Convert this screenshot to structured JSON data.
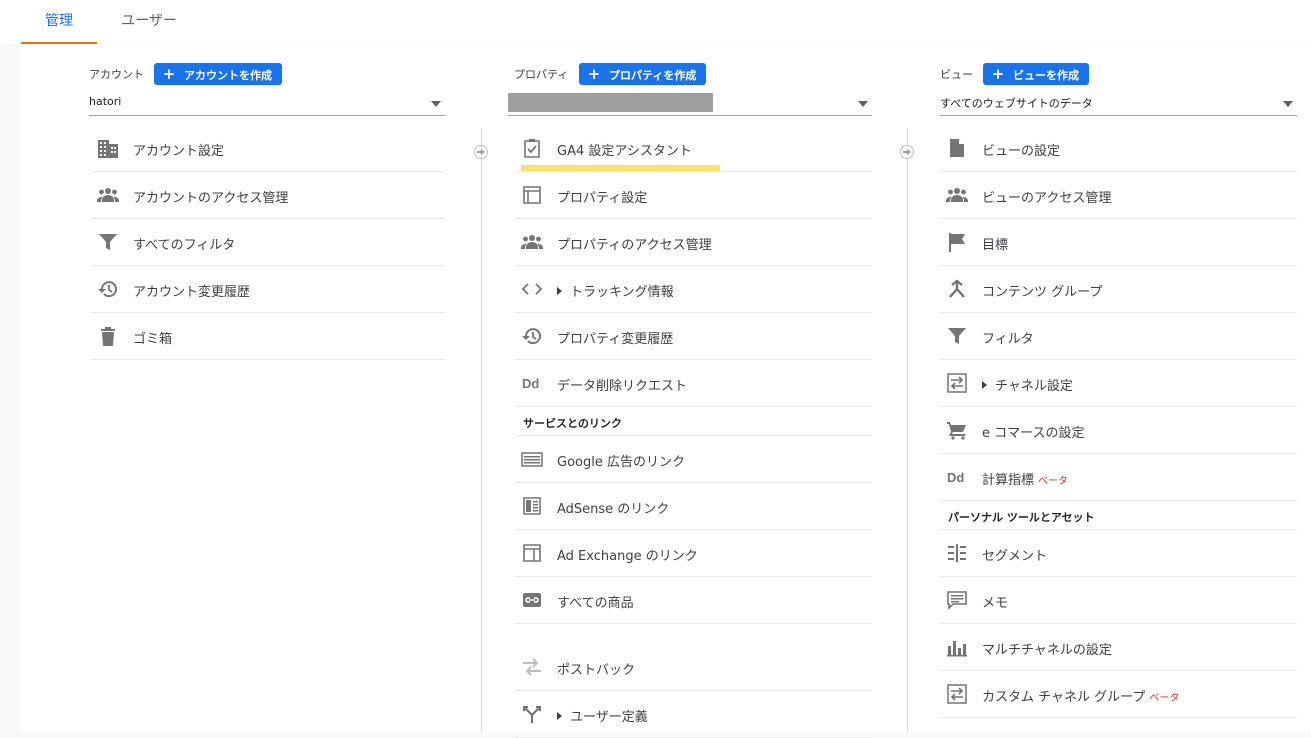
{
  "tabs": [
    {
      "label": "管理",
      "active": true
    },
    {
      "label": "ユーザー",
      "active": false
    }
  ],
  "account": {
    "label": "アカウント",
    "create_label": "アカウントを作成",
    "selected": "hatori",
    "items": [
      {
        "icon": "building-icon",
        "label": "アカウント設定"
      },
      {
        "icon": "people-icon",
        "label": "アカウントのアクセス管理"
      },
      {
        "icon": "filter-icon",
        "label": "すべてのフィルタ"
      },
      {
        "icon": "history-icon",
        "label": "アカウント変更履歴"
      },
      {
        "icon": "trash-icon",
        "label": "ゴミ箱"
      }
    ]
  },
  "property": {
    "label": "プロパティ",
    "create_label": "プロパティを作成",
    "selected": "",
    "items": [
      {
        "icon": "clipboard-check-icon",
        "label": "GA4 設定アシスタント"
      },
      {
        "icon": "layout-icon",
        "label": "プロパティ設定"
      },
      {
        "icon": "people-icon",
        "label": "プロパティのアクセス管理"
      },
      {
        "icon": "code-icon",
        "label": "トラッキング情報"
      },
      {
        "icon": "history-icon",
        "label": "プロパティ変更履歴"
      },
      {
        "icon": "dd-icon",
        "label": "データ削除リクエスト"
      }
    ],
    "section_label": "サービスとのリンク",
    "link_items": [
      {
        "icon": "ads-icon",
        "label": "Google 広告のリンク"
      },
      {
        "icon": "adsense-icon",
        "label": "AdSense のリンク"
      },
      {
        "icon": "ad-exchange-icon",
        "label": "Ad Exchange のリンク"
      },
      {
        "icon": "link-icon",
        "label": "すべての商品"
      }
    ],
    "extra_items": [
      {
        "icon": "postback-icon",
        "label": "ポストバック"
      },
      {
        "icon": "fork-icon",
        "label": "ユーザー定義"
      }
    ]
  },
  "view": {
    "label": "ビュー",
    "create_label": "ビューを作成",
    "selected": "すべてのウェブサイトのデータ",
    "items": [
      {
        "icon": "document-icon",
        "label": "ビューの設定"
      },
      {
        "icon": "people-icon",
        "label": "ビューのアクセス管理"
      },
      {
        "icon": "flag-icon",
        "label": "目標"
      },
      {
        "icon": "content-group-icon",
        "label": "コンテンツ グループ"
      },
      {
        "icon": "filter-icon",
        "label": "フィルタ"
      },
      {
        "icon": "channel-icon",
        "label": "チャネル設定"
      },
      {
        "icon": "cart-icon",
        "label": "e コマースの設定"
      },
      {
        "icon": "dd-icon",
        "label": "計算指標",
        "badge": "ベータ"
      }
    ],
    "section_label": "パーソナル ツールとアセット",
    "tool_items": [
      {
        "icon": "segment-icon",
        "label": "セグメント"
      },
      {
        "icon": "memo-icon",
        "label": "メモ"
      },
      {
        "icon": "multichannel-icon",
        "label": "マルチチャネルの設定"
      },
      {
        "icon": "channel-icon",
        "label": "カスタム チャネル グループ",
        "badge": "ベータ"
      }
    ]
  },
  "colors": {
    "accent": "#1a73e8",
    "tab_indicator": "#e8710a",
    "highlight": "#fde16e",
    "beta": "#d93025",
    "icon": "#757575"
  }
}
